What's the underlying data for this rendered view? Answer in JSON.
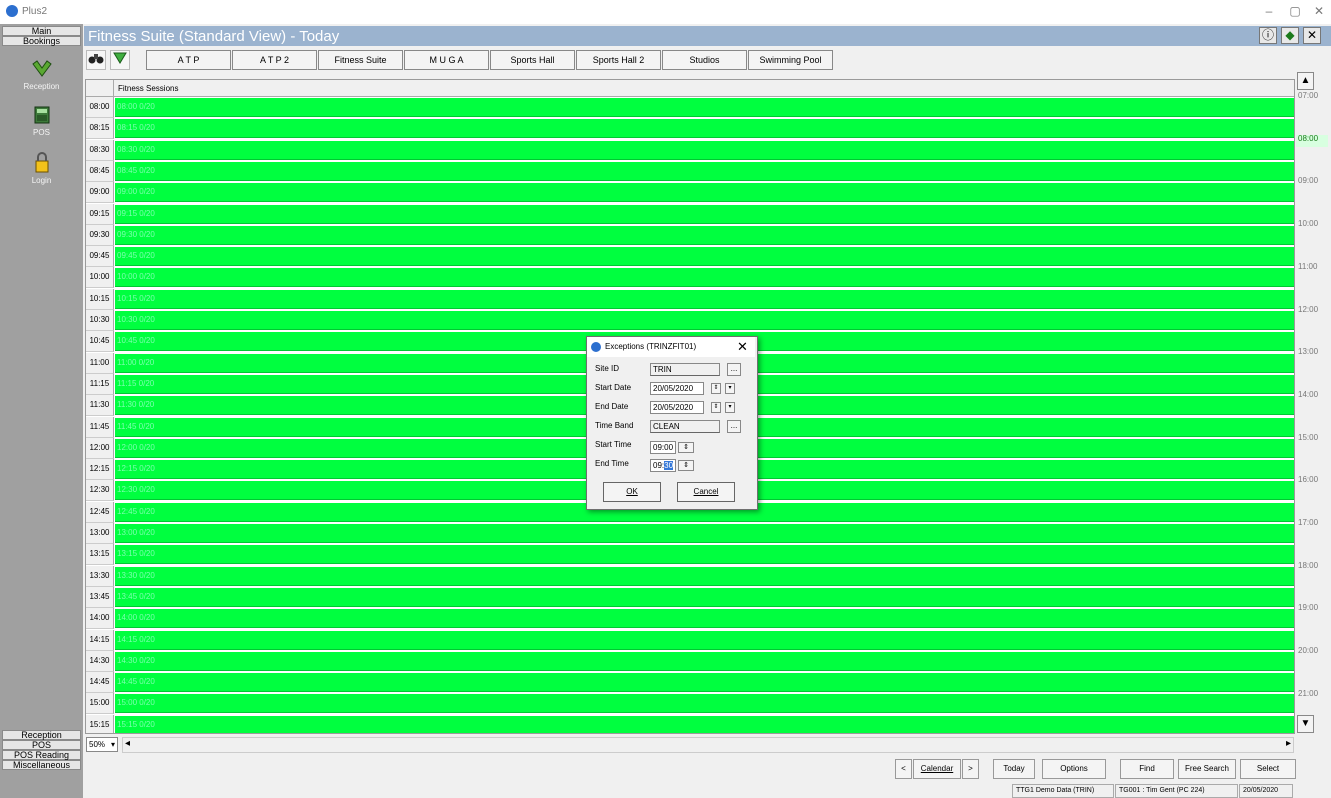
{
  "window": {
    "app_title": "Plus2",
    "minimize": "–",
    "maximize": "▢",
    "close": "✕"
  },
  "leftnav": {
    "top_tabs": [
      "Main",
      "Bookings"
    ],
    "items": [
      {
        "label": "Reception",
        "icon": "reception-icon"
      },
      {
        "label": "POS",
        "icon": "pos-icon"
      },
      {
        "label": "Login",
        "icon": "login-icon"
      }
    ],
    "bottom_tabs": [
      "Reception",
      "POS",
      "POS Reading",
      "Miscellaneous"
    ]
  },
  "panel": {
    "title": "Fitness Suite (Standard View) - Today",
    "info_icon": "ⓘ",
    "nav_icon": "◆",
    "close_icon": "✕"
  },
  "toolbar": {
    "find_icon": "binoculars-icon",
    "filter_icon": "filter-icon",
    "tabs": [
      "A T P",
      "A T P 2",
      "Fitness Suite",
      "M U G A",
      "Sports Hall",
      "Sports Hall 2",
      "Studios",
      "Swimming Pool"
    ]
  },
  "grid": {
    "column_header": "Fitness Sessions",
    "rows": [
      {
        "time": "08:00",
        "slot": "08:00 0/20"
      },
      {
        "time": "08:15",
        "slot": "08:15 0/20"
      },
      {
        "time": "08:30",
        "slot": "08:30 0/20"
      },
      {
        "time": "08:45",
        "slot": "08:45 0/20"
      },
      {
        "time": "09:00",
        "slot": "09:00 0/20"
      },
      {
        "time": "09:15",
        "slot": "09:15 0/20"
      },
      {
        "time": "09:30",
        "slot": "09:30 0/20"
      },
      {
        "time": "09:45",
        "slot": "09:45 0/20"
      },
      {
        "time": "10:00",
        "slot": "10:00 0/20"
      },
      {
        "time": "10:15",
        "slot": "10:15 0/20"
      },
      {
        "time": "10:30",
        "slot": "10:30 0/20"
      },
      {
        "time": "10:45",
        "slot": "10:45 0/20"
      },
      {
        "time": "11:00",
        "slot": "11:00 0/20"
      },
      {
        "time": "11:15",
        "slot": "11:15 0/20"
      },
      {
        "time": "11:30",
        "slot": "11:30 0/20"
      },
      {
        "time": "11:45",
        "slot": "11:45 0/20"
      },
      {
        "time": "12:00",
        "slot": "12:00 0/20"
      },
      {
        "time": "12:15",
        "slot": "12:15 0/20"
      },
      {
        "time": "12:30",
        "slot": "12:30 0/20"
      },
      {
        "time": "12:45",
        "slot": "12:45 0/20"
      },
      {
        "time": "13:00",
        "slot": "13:00 0/20"
      },
      {
        "time": "13:15",
        "slot": "13:15 0/20"
      },
      {
        "time": "13:30",
        "slot": "13:30 0/20"
      },
      {
        "time": "13:45",
        "slot": "13:45 0/20"
      },
      {
        "time": "14:00",
        "slot": "14:00 0/20"
      },
      {
        "time": "14:15",
        "slot": "14:15 0/20"
      },
      {
        "time": "14:30",
        "slot": "14:30 0/20"
      },
      {
        "time": "14:45",
        "slot": "14:45 0/20"
      },
      {
        "time": "15:00",
        "slot": "15:00 0/20"
      },
      {
        "time": "15:15",
        "slot": "15:15 0/20"
      }
    ]
  },
  "ruler": {
    "labels": [
      "07:00",
      "08:00",
      "09:00",
      "10:00",
      "11:00",
      "12:00",
      "13:00",
      "14:00",
      "15:00",
      "16:00",
      "17:00",
      "18:00",
      "19:00",
      "20:00",
      "21:00"
    ],
    "current": "08:00",
    "up": "▲",
    "down": "▼"
  },
  "bottom": {
    "zoom": "50%",
    "zoom_arrow": "▾",
    "prev": "<",
    "calendar": "Calendar",
    "next": ">",
    "today": "Today",
    "options": "Options",
    "find": "Find",
    "free_search": "Free Search",
    "select": "Select"
  },
  "status": [
    "TTG1 Demo Data (TRIN)",
    "TG001 : Tim Gent (PC 224)",
    "20/05/2020"
  ],
  "dialog": {
    "title": "Exceptions (TRINZFIT01)",
    "close": "✕",
    "site_id_label": "Site ID",
    "site_id": "TRIN",
    "start_date_label": "Start Date",
    "start_date": "20/05/2020",
    "end_date_label": "End Date",
    "end_date": "20/05/2020",
    "time_band_label": "Time Band",
    "time_band": "CLEAN",
    "start_time_label": "Start Time",
    "start_time": "09:00",
    "end_time_label": "End Time",
    "end_time_prefix": "09:",
    "end_time_selected": "30",
    "ellipsis": "...",
    "ok": "OK",
    "cancel": "Cancel"
  },
  "colors": {
    "slot_green": "#00ff3f",
    "panel_title_bg": "#9bb3cf",
    "nav_bg": "#a0a0a0"
  }
}
